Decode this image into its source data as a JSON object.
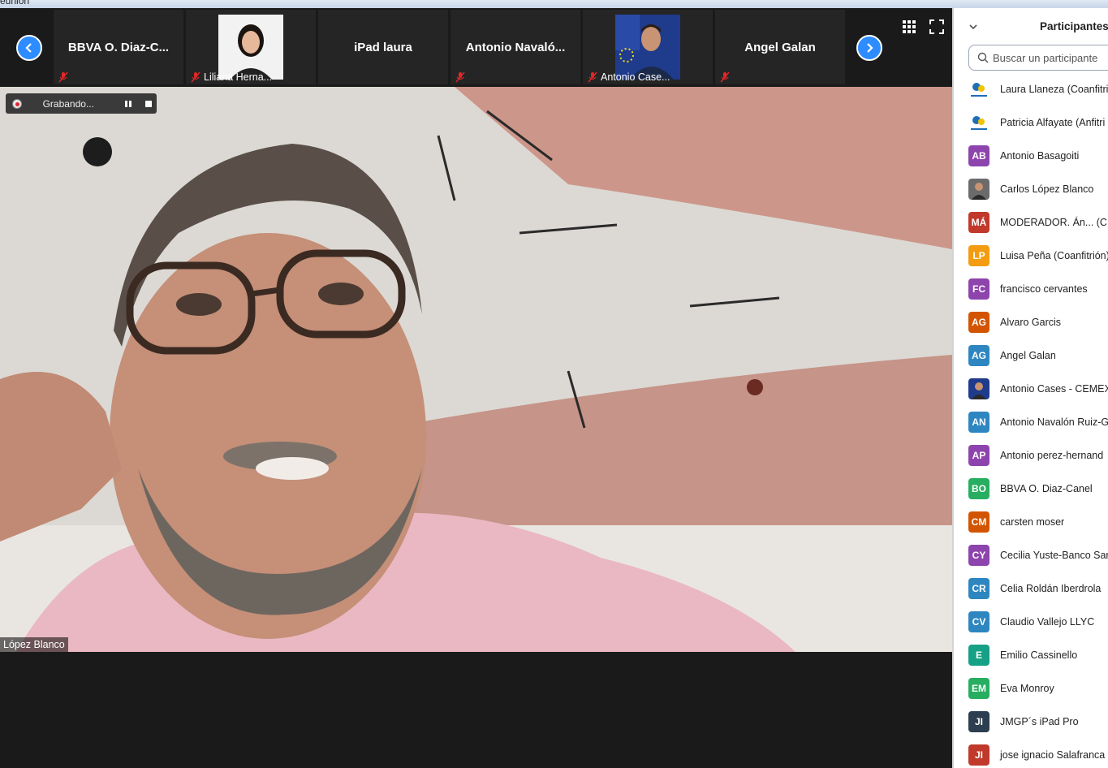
{
  "window": {
    "title": "eunión"
  },
  "strip": {
    "thumbs": [
      {
        "name": "BBVA O. Diaz-C...",
        "sub": ""
      },
      {
        "name": "",
        "sub": "Liliana Herna..."
      },
      {
        "name": "iPad laura",
        "sub": ""
      },
      {
        "name": "Antonio  Navaló...",
        "sub": ""
      },
      {
        "name": "",
        "sub": "Antonio Case..."
      },
      {
        "name": "Angel Galan",
        "sub": ""
      }
    ]
  },
  "recording": {
    "label": "Grabando..."
  },
  "speaker": {
    "name": "López Blanco"
  },
  "panel": {
    "title": "Participantes (",
    "search_placeholder": "Buscar un participante",
    "participants": [
      {
        "initials": "",
        "name": "Laura Llaneza (Coanfitri",
        "color": "#ffffff",
        "avatar": "logo"
      },
      {
        "initials": "",
        "name": "Patricia Alfayate (Anfitri",
        "color": "#ffffff",
        "avatar": "logo"
      },
      {
        "initials": "AB",
        "name": "Antonio Basagoiti",
        "color": "#8e44ad"
      },
      {
        "initials": "",
        "name": "Carlos López Blanco",
        "color": "#6b6b6b",
        "avatar": "photo"
      },
      {
        "initials": "MÁ",
        "name": "MODERADOR. Án...   (C",
        "color": "#c0392b"
      },
      {
        "initials": "LP",
        "name": "Luisa Peña (Coanfitrión)",
        "color": "#f39c12"
      },
      {
        "initials": "FC",
        "name": "francisco cervantes",
        "color": "#8e44ad"
      },
      {
        "initials": "AG",
        "name": "Alvaro Garcis",
        "color": "#d35400"
      },
      {
        "initials": "AG",
        "name": "Angel Galan",
        "color": "#2e86c1"
      },
      {
        "initials": "",
        "name": "Antonio Cases - CEMEX",
        "color": "#1f3b8c",
        "avatar": "photo"
      },
      {
        "initials": "AN",
        "name": "Antonio Navalón Ruiz-G",
        "color": "#2e86c1"
      },
      {
        "initials": "AP",
        "name": "Antonio perez-hernand",
        "color": "#8e44ad"
      },
      {
        "initials": "BO",
        "name": "BBVA O. Diaz-Canel",
        "color": "#27ae60"
      },
      {
        "initials": "CM",
        "name": "carsten moser",
        "color": "#d35400"
      },
      {
        "initials": "CY",
        "name": "Cecilia Yuste-Banco Sar",
        "color": "#8e44ad"
      },
      {
        "initials": "CR",
        "name": "Celia Roldán Iberdrola",
        "color": "#2e86c1"
      },
      {
        "initials": "CV",
        "name": "Claudio Vallejo LLYC",
        "color": "#2e86c1"
      },
      {
        "initials": "E",
        "name": "Emilio Cassinello",
        "color": "#16a085"
      },
      {
        "initials": "EM",
        "name": "Eva Monroy",
        "color": "#27ae60"
      },
      {
        "initials": "JI",
        "name": "JMGP´s iPad Pro",
        "color": "#2c3e50"
      },
      {
        "initials": "JI",
        "name": "jose ignacio Salafranca",
        "color": "#c0392b"
      }
    ]
  },
  "colors": {
    "accent": "#2d8cff",
    "muted_mic": "#e02828",
    "stage_bg": "#1a1a1a"
  },
  "icons": [
    "chevron-left-icon",
    "chevron-right-icon",
    "grid-view-icon",
    "fullscreen-icon",
    "mic-muted-icon",
    "record-icon",
    "pause-icon",
    "stop-icon",
    "search-icon",
    "chevron-down-icon"
  ]
}
